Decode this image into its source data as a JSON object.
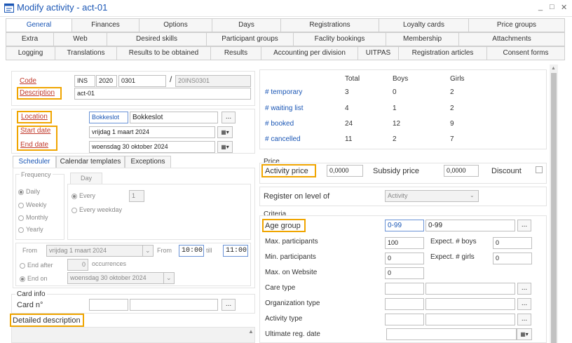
{
  "window": {
    "title": "Modify activity - act-01",
    "min": "_",
    "max": "□",
    "close": "✕"
  },
  "tabs": {
    "row1": [
      "General",
      "Finances",
      "Options",
      "Days",
      "Registrations",
      "Loyalty cards",
      "Price groups"
    ],
    "row2": [
      "Extra",
      "Web",
      "Desired skills",
      "Participant groups",
      "Faclity bookings",
      "Membership",
      "Attachments"
    ],
    "row3": [
      "Logging",
      "Translations",
      "Results to be obtained",
      "Results",
      "Accounting per division",
      "UITPAS",
      "Registration articles",
      "Consent forms"
    ]
  },
  "form": {
    "code_label": "Code",
    "code_parts": [
      "INS",
      "2020",
      "0301"
    ],
    "code_sep": "/",
    "code_full": "20INS0301",
    "description_label": "Description",
    "description_value": "act-01",
    "location_label": "Location",
    "location_code": "Bokkeslot",
    "location_name": "Bokkeslot",
    "start_label": "Start date",
    "start_value": "vrijdag 1 maart 2024",
    "end_label": "End date",
    "end_value": "woensdag 30 oktober 2024",
    "ellipsis": "..."
  },
  "scheduler": {
    "tabs": [
      "Scheduler",
      "Calendar templates",
      "Exceptions"
    ],
    "frequency_label": "Frequency",
    "frequencies": [
      "Daily",
      "Weekly",
      "Monthly",
      "Yearly"
    ],
    "day_tab": "Day",
    "every_label": "Every",
    "every_value": "1",
    "every_weekday": "Every weekday",
    "from_label": "From",
    "from_date": "vrijdag 1 maart 2024",
    "from_label2": "From",
    "time_from": "10:00",
    "till_label": "till",
    "time_till": "11:00",
    "end_after": "End after",
    "occurrences_value": "0",
    "occurrences_label": "occurrences",
    "end_on": "End on",
    "end_on_date": "woensdag 30 oktober 2024"
  },
  "card_info": {
    "title": "Card info",
    "card_label": "Card n°"
  },
  "detailed_description_label": "Detailed description",
  "stats": {
    "headers": [
      "Total",
      "Boys",
      "Girls"
    ],
    "rows": [
      {
        "label": "# temporary",
        "total": "3",
        "boys": "0",
        "girls": "2"
      },
      {
        "label": "# waiting list",
        "total": "4",
        "boys": "1",
        "girls": "2"
      },
      {
        "label": "# booked",
        "total": "24",
        "boys": "12",
        "girls": "9"
      },
      {
        "label": "# cancelled",
        "total": "11",
        "boys": "2",
        "girls": "7"
      }
    ]
  },
  "price": {
    "section": "Price",
    "activity_label": "Activity price",
    "activity_value": "0,0000",
    "subsidy_label": "Subsidy price",
    "subsidy_value": "0,0000",
    "discount_label": "Discount"
  },
  "register": {
    "label": "Register on level of",
    "value": "Activity"
  },
  "criteria": {
    "section": "Criteria",
    "age_label": "Age group",
    "age_code": "0-99",
    "age_name": "0-99",
    "max_participants_label": "Max. participants",
    "max_participants": "100",
    "expect_boys_label": "Expect. # boys",
    "expect_boys": "0",
    "min_participants_label": "Min. participants",
    "min_participants": "0",
    "expect_girls_label": "Expect. # girls",
    "expect_girls": "0",
    "max_web_label": "Max. on Website",
    "max_web": "0",
    "care_label": "Care type",
    "org_label": "Organization type",
    "activity_type_label": "Activity type",
    "ultimate_label": "Ultimate reg. date"
  },
  "colors": {
    "accent": "#1a56b5",
    "highlight": "#f0a500",
    "required": "#c0392b"
  }
}
